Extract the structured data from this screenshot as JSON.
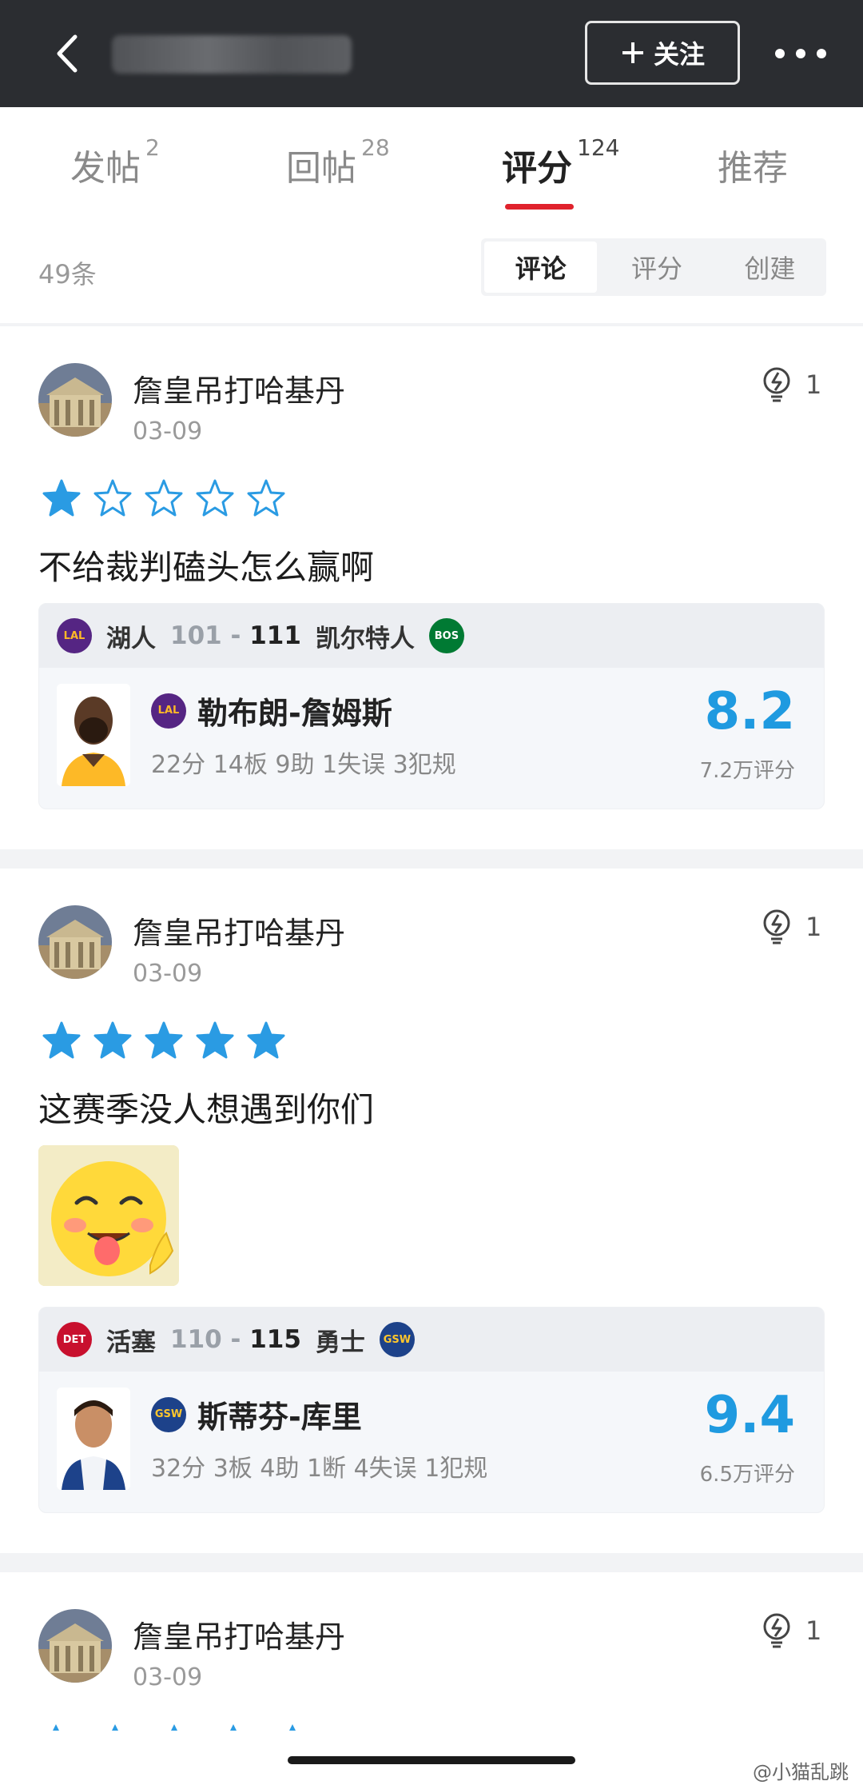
{
  "header": {
    "follow_label": "关注"
  },
  "tabs": [
    {
      "label": "发帖",
      "count": "2"
    },
    {
      "label": "回帖",
      "count": "28"
    },
    {
      "label": "评分",
      "count": "124"
    },
    {
      "label": "推荐",
      "count": ""
    }
  ],
  "filter": {
    "count_text": "49条",
    "segments": [
      "评论",
      "评分",
      "创建"
    ],
    "selected": "评论"
  },
  "posts": [
    {
      "user": "詹皇吊打哈基丹",
      "date": "03-09",
      "likes": "1",
      "stars": 1,
      "comment": "不给裁判磕头怎么赢啊",
      "card": {
        "home_team": "湖人",
        "home_score": "101",
        "sep": "-",
        "away_score": "111",
        "away_team": "凯尔特人",
        "home_logo": "LAL",
        "away_logo": "BOS",
        "player_team_logo": "LAL",
        "player": "勒布朗-詹姆斯",
        "stats": "22分 14板 9助 1失误 3犯规",
        "rating": "8.2",
        "rating_count": "7.2万评分"
      }
    },
    {
      "user": "詹皇吊打哈基丹",
      "date": "03-09",
      "likes": "1",
      "stars": 5,
      "comment": "这赛季没人想遇到你们",
      "card": {
        "home_team": "活塞",
        "home_score": "110",
        "sep": "-",
        "away_score": "115",
        "away_team": "勇士",
        "home_logo": "DET",
        "away_logo": "GSW",
        "player_team_logo": "GSW",
        "player": "斯蒂芬-库里",
        "stats": "32分 3板 4助 1断 4失误 1犯规",
        "rating": "9.4",
        "rating_count": "6.5万评分"
      }
    },
    {
      "user": "詹皇吊打哈基丹",
      "date": "03-09",
      "likes": "1"
    }
  ],
  "watermark": "@小猫乱跳",
  "colors": {
    "accent_red": "#e0222c",
    "rating_blue": "#1f9ae0",
    "star_blue": "#2a9be3"
  }
}
